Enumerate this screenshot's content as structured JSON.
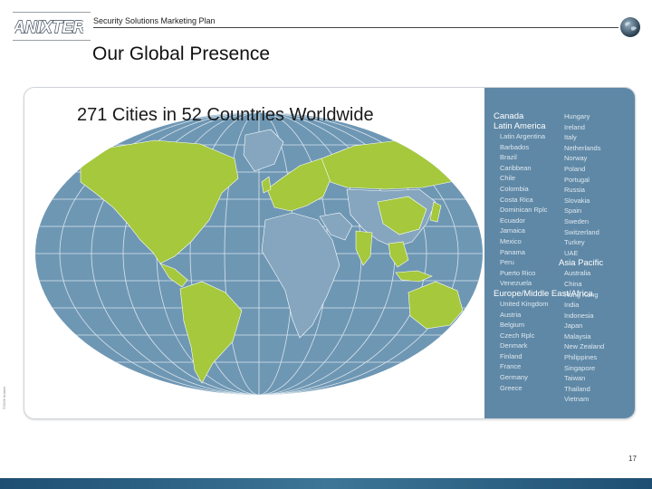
{
  "header": {
    "logo_text": "ANIXTER",
    "subtitle": "Security Solutions Marketing Plan"
  },
  "title": "Our Global Presence",
  "map": {
    "heading": "271 Cities in 52 Countries Worldwide",
    "colors": {
      "ocean": "#6e97b4",
      "presence": "#a5c83c",
      "other_land": "#86a6bf"
    }
  },
  "regions": {
    "left": [
      {
        "name": "Canada",
        "countries": []
      },
      {
        "name": "Latin America",
        "countries": [
          "Latin Argentina",
          "Barbados",
          "Brazil",
          "Caribbean",
          "Chile",
          "Colombia",
          "Costa Rica",
          "Dominican Rplc",
          "Ecuador",
          "Jamaica",
          "Mexico",
          "Panama",
          "Peru",
          "Puerto Rico",
          "Venezuela"
        ]
      },
      {
        "name": "Europe/Middle East/Africa",
        "countries": [
          "United Kingdom",
          "Austria",
          "Belgium",
          "Czech Rplc",
          "Denmark",
          "Finland",
          "France",
          "Germany",
          "Greece"
        ]
      }
    ],
    "right": [
      {
        "name": "",
        "countries": [
          "Hungary",
          "Ireland",
          "Italy",
          "Netherlands",
          "Norway",
          "Poland",
          "Portugal",
          "Russia",
          "Slovakia",
          "Spain",
          "Sweden",
          "Switzerland",
          "Turkey",
          "UAE"
        ]
      },
      {
        "name": "Asia Pacific",
        "countries": [
          "Australia",
          "China",
          "Hong Kong",
          "India",
          "Indonesia",
          "Japan",
          "Malaysia",
          "New Zealand",
          "Philippines",
          "Singapore",
          "Taiwan",
          "Thailand",
          "Vietnam"
        ]
      }
    ]
  },
  "footer": {
    "side_mark": "©2006 Anixter",
    "page_number": "17"
  }
}
